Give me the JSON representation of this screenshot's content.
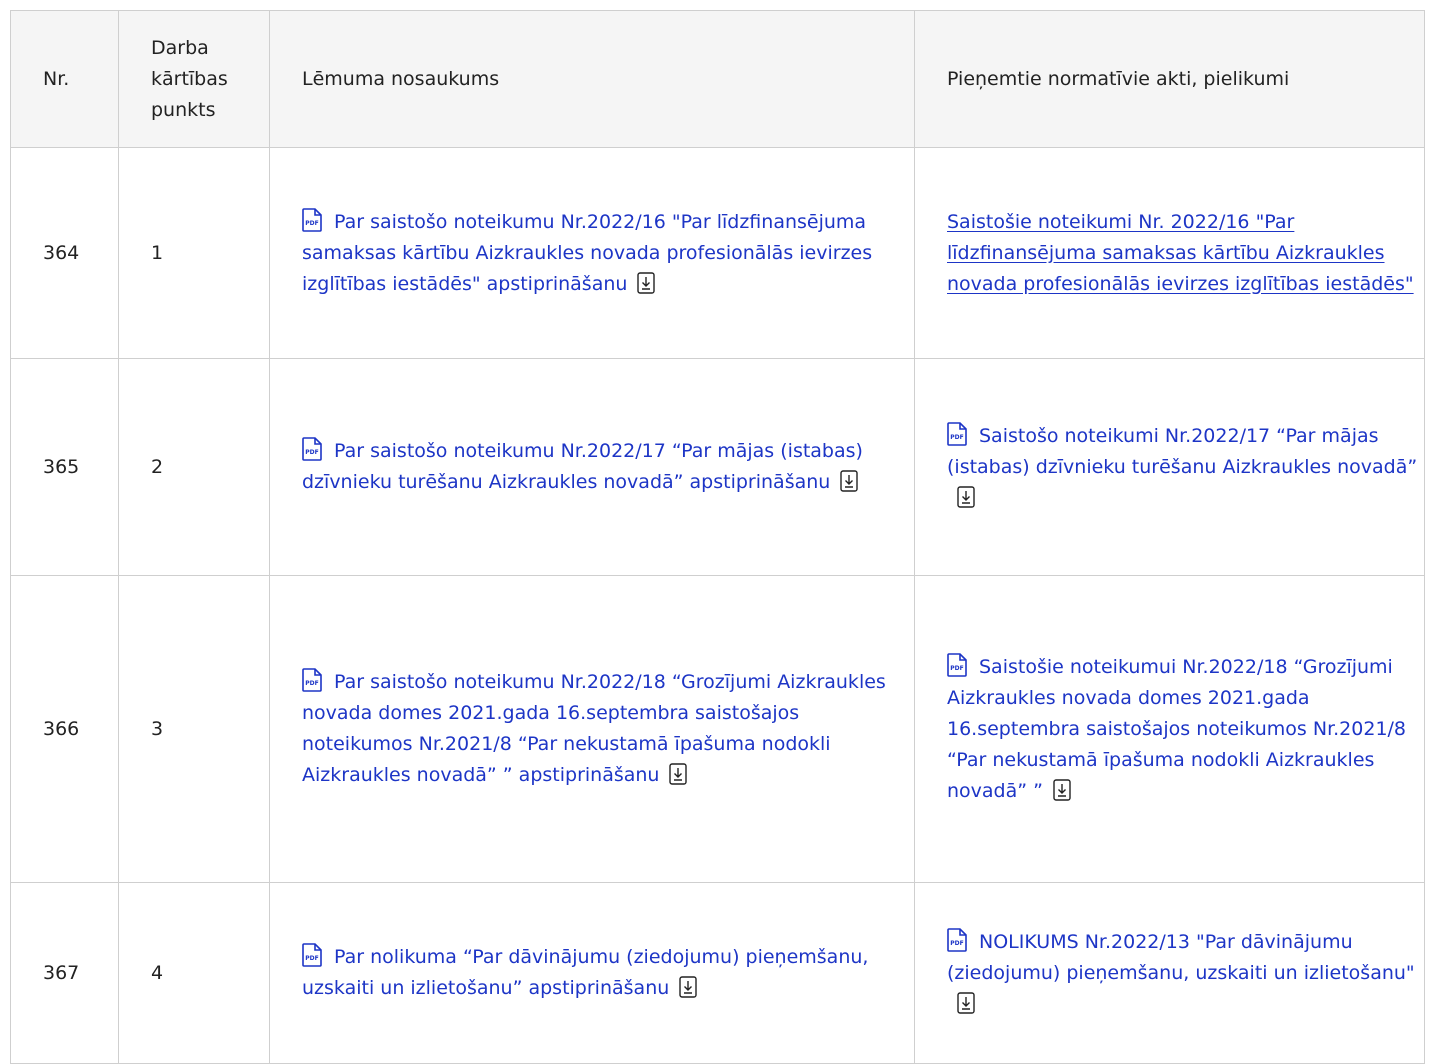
{
  "headers": {
    "nr": "Nr.",
    "point": "Darba kārtības punkts",
    "name": "Lēmuma nosaukums",
    "acts": "Pieņemtie normatīvie akti, pielikumi"
  },
  "rows": [
    {
      "nr": "364",
      "point": "1",
      "decision": "Par saistošo noteikumu Nr.2022/16 \"Par līdzfinansējuma samaksas kārtību Aizkraukles novada profesionālās ievirzes izglītības iestādēs\" apstiprināšanu",
      "act": "Saistošie noteikumi Nr. 2022/16 \"Par līdzfinansējuma samaksas kārtību Aizkraukles novada profesionālās ievirzes izglītības iestādēs\""
    },
    {
      "nr": "365",
      "point": "2",
      "decision": "Par saistošo noteikumu Nr.2022/17 “Par mājas (istabas) dzīvnieku turēšanu Aizkraukles novadā” apstiprināšanu",
      "act": "Saistošo noteikumi Nr.2022/17 “Par mājas (istabas) dzīvnieku turēšanu Aizkraukles novadā”"
    },
    {
      "nr": "366",
      "point": "3",
      "decision": "Par saistošo noteikumu Nr.2022/18 “Grozījumi Aizkraukles novada domes 2021.gada 16.septembra saistošajos noteikumos Nr.2021/8 “Par nekustamā īpašuma nodokli Aizkraukles novadā” ” apstiprināšanu",
      "act": "Saistošie noteikumui Nr.2022/18 “Grozījumi Aizkraukles novada domes 2021.gada 16.septembra saistošajos noteikumos Nr.2021/8 “Par nekustamā īpašuma nodokli Aizkraukles novadā” ”"
    },
    {
      "nr": "367",
      "point": "4",
      "decision": "Par nolikuma “Par dāvinājumu (ziedojumu) pieņemšanu, uzskaiti un izlietošanu” apstiprināšanu",
      "act": "NOLIKUMS Nr.2022/13 \"Par dāvinājumu (ziedojumu) pieņemšanu, uzskaiti un izlietošanu\""
    }
  ],
  "icons": {
    "pdf": "pdf-file-icon",
    "download": "download-icon",
    "pdf_badge_text": "PDF"
  },
  "colors": {
    "link": "#1d35c6",
    "header_bg": "#f5f5f5",
    "border": "#cfcfcf",
    "text": "#222222"
  }
}
